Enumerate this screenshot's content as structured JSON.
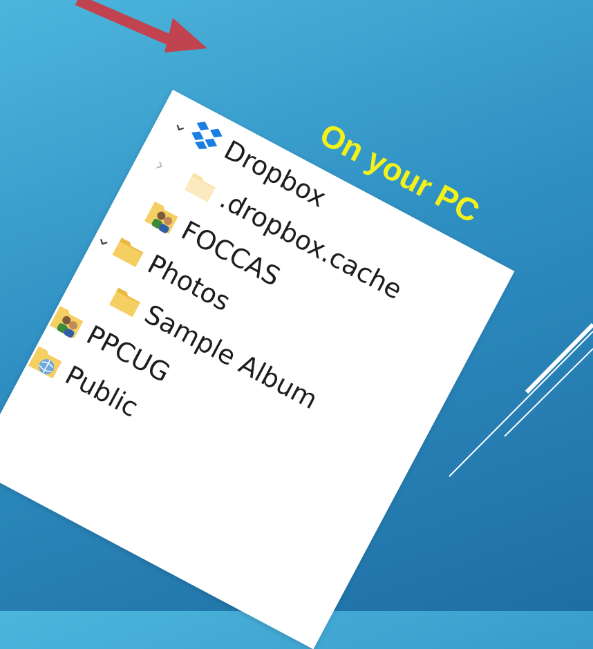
{
  "caption": "On your PC",
  "tree": [
    {
      "label": "Dropbox",
      "icon": "dropbox-icon",
      "chevron": "expanded"
    },
    {
      "label": ".dropbox.cache",
      "icon": "folder-icon",
      "chevron": "collapsed"
    },
    {
      "label": "FOCCAS",
      "icon": "shared-folder-icon",
      "chevron": "none"
    },
    {
      "label": "Photos",
      "icon": "folder-icon",
      "chevron": "expanded"
    },
    {
      "label": "Sample Album",
      "icon": "folder-icon",
      "chevron": "none"
    },
    {
      "label": "PPCUG",
      "icon": "shared-folder-icon",
      "chevron": "none"
    },
    {
      "label": "Public",
      "icon": "public-folder-icon",
      "chevron": "none"
    }
  ],
  "colors": {
    "background_top": "#4cb6dc",
    "background_bottom": "#1e6ea3",
    "caption": "#f2f21a",
    "arrow": "#c0434f",
    "folder": "#f6cf63",
    "dropbox": "#1a7fe0"
  }
}
